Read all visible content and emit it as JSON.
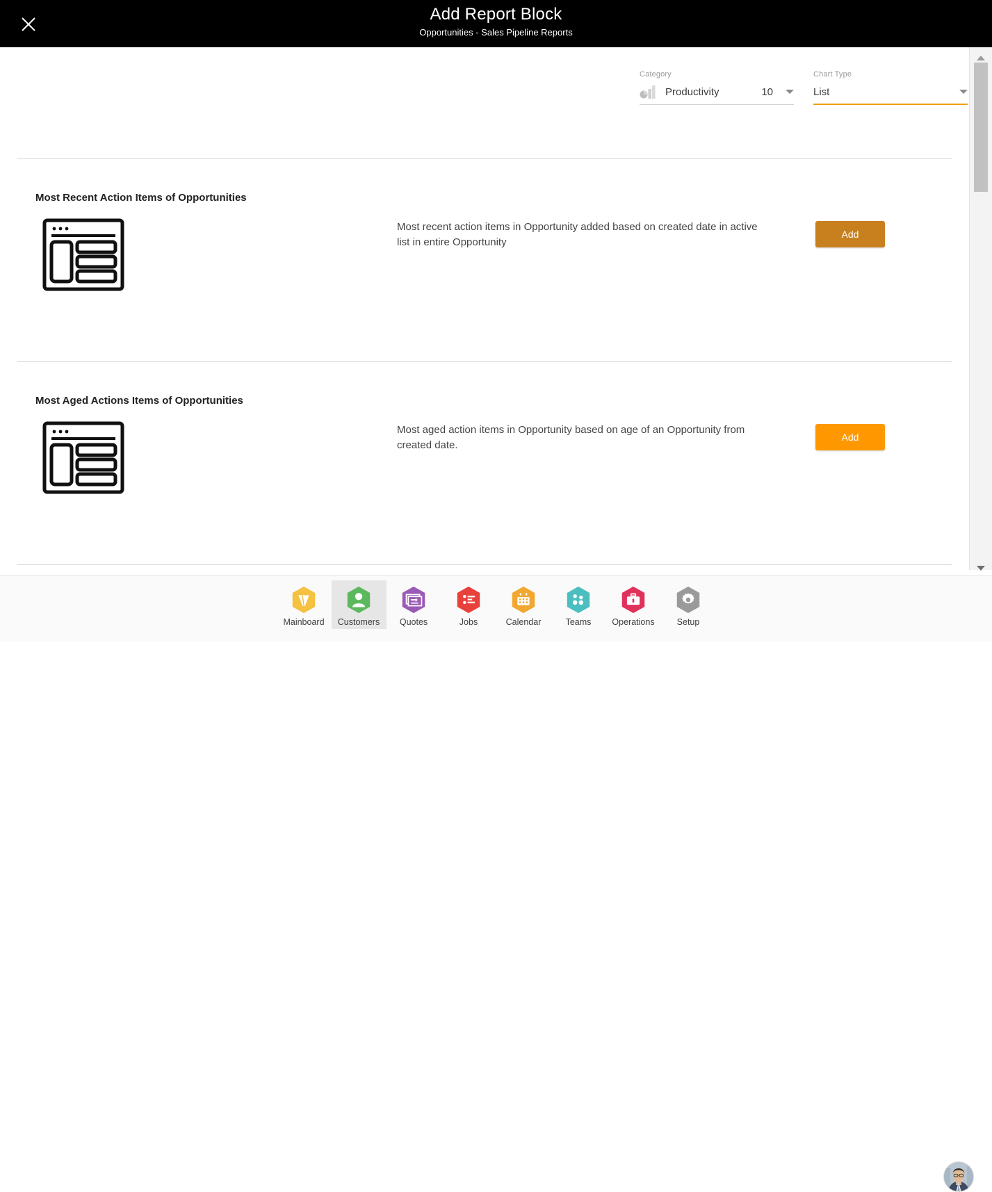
{
  "window": {
    "title": "Add Report Block",
    "subtitle": "Opportunities - Sales Pipeline Reports",
    "close_icon": "close-icon"
  },
  "filters": {
    "category": {
      "label": "Category",
      "value": "Productivity",
      "count": "10",
      "icon": "bar-chart-icon",
      "caret_icon": "chevron-down-icon"
    },
    "chart_type": {
      "label": "Chart Type",
      "value": "List",
      "caret_icon": "chevron-down-icon",
      "underline_color": "#f39c12"
    }
  },
  "blocks": [
    {
      "title": "Most Recent Action Items of Opportunities",
      "description": "Most recent action items in Opportunity added based on created date in active list in entire Opportunity",
      "thumb_icon": "list-layout-icon",
      "add_label": "Add",
      "add_color": "#c8801f"
    },
    {
      "title": "Most Aged Actions Items of Opportunities",
      "description": "Most aged action items in Opportunity based on age of an Opportunity from created date.",
      "thumb_icon": "list-layout-icon",
      "add_label": "Add",
      "add_color": "#ff9800"
    }
  ],
  "scrollbar": {
    "up_icon": "scroll-up-arrow-icon",
    "down_icon": "scroll-down-arrow-icon"
  },
  "bottom_nav": {
    "items": [
      {
        "label": "Mainboard",
        "icon": "mainboard-icon",
        "color": "#f5c141",
        "active": false
      },
      {
        "label": "Customers",
        "icon": "customers-icon",
        "color": "#5cb85c",
        "active": true
      },
      {
        "label": "Quotes",
        "icon": "quotes-icon",
        "color": "#9b59b6",
        "active": false
      },
      {
        "label": "Jobs",
        "icon": "jobs-icon",
        "color": "#e8413c",
        "active": false
      },
      {
        "label": "Calendar",
        "icon": "calendar-icon",
        "color": "#f0a830",
        "active": false
      },
      {
        "label": "Teams",
        "icon": "teams-icon",
        "color": "#4bbfc0",
        "active": false
      },
      {
        "label": "Operations",
        "icon": "operations-icon",
        "color": "#e0315b",
        "active": false
      },
      {
        "label": "Setup",
        "icon": "setup-icon",
        "color": "#9a9a9a",
        "active": false
      }
    ],
    "avatar_icon": "user-avatar"
  }
}
